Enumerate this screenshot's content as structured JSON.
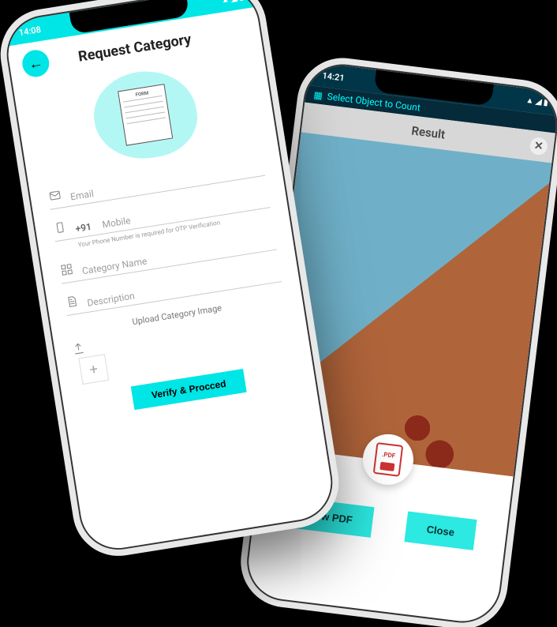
{
  "status": {
    "time": "14:08",
    "signal_icons": "▲ ◢ ▮"
  },
  "phoneA": {
    "title": "Request Category",
    "form_icon_label": "FORM",
    "email": {
      "placeholder": "Email"
    },
    "mobile": {
      "prefix": "+91",
      "placeholder": "Mobile",
      "note": "Your Phone Number is required for OTP Verification"
    },
    "category": {
      "placeholder": "Category Name"
    },
    "description": {
      "placeholder": "Description"
    },
    "upload_label": "Upload Category Image",
    "verify_label": "Verify & Procced"
  },
  "phoneB": {
    "select_header": "Select Object to Count",
    "result_title": "Result",
    "pdf_badge": ".PDF",
    "view_pdf_label": "View PDF",
    "close_label": "Close",
    "status_time": "14:21"
  }
}
